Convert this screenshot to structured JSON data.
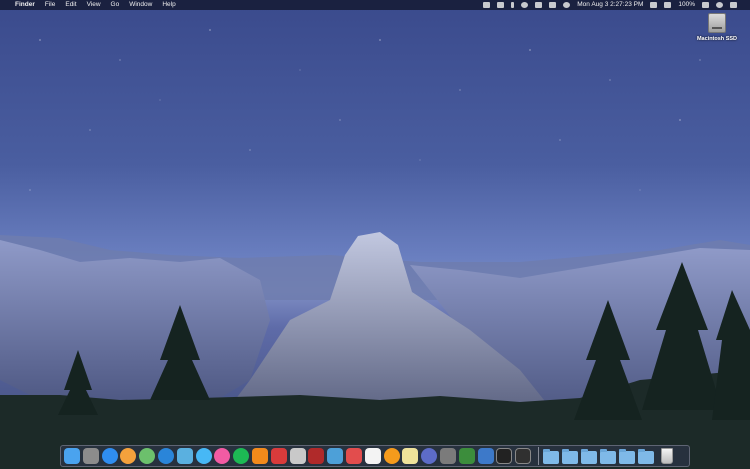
{
  "menubar": {
    "apple_glyph": "",
    "app_name": "Finder",
    "menus": [
      "File",
      "Edit",
      "View",
      "Go",
      "Window",
      "Help"
    ],
    "status": {
      "date_time": "Mon Aug 3  2:27:23 PM",
      "battery": "100%"
    }
  },
  "desktop": {
    "drive_label": "Macintosh SSD"
  },
  "dock": {
    "apps": [
      {
        "name": "finder-icon",
        "color": "#4aa3ef"
      },
      {
        "name": "system-preferences-icon",
        "color": "#8c8c8c"
      },
      {
        "name": "app-store-icon",
        "color": "#2f8df0"
      },
      {
        "name": "photos-icon",
        "color": "#f4a13c"
      },
      {
        "name": "maps-icon",
        "color": "#6cc06c"
      },
      {
        "name": "safari-icon",
        "color": "#2a85d9"
      },
      {
        "name": "preview-icon",
        "color": "#5ab0e0"
      },
      {
        "name": "messages-icon",
        "color": "#47b8f5"
      },
      {
        "name": "itunes-icon",
        "color": "#f25ba3"
      },
      {
        "name": "spotify-icon",
        "color": "#1db954"
      },
      {
        "name": "vlc-icon",
        "color": "#f28a1b"
      },
      {
        "name": "popcorn-icon",
        "color": "#d83b3b"
      },
      {
        "name": "script-editor-icon",
        "color": "#c9c9c9"
      },
      {
        "name": "tunnel-app-icon",
        "color": "#b02a2a"
      },
      {
        "name": "dolphin-icon",
        "color": "#4da0d8"
      },
      {
        "name": "flashcard-icon",
        "color": "#e24d4d"
      },
      {
        "name": "calendar-icon",
        "color": "#f3f3f3"
      },
      {
        "name": "ibooks-icon",
        "color": "#f59b1c"
      },
      {
        "name": "notes-icon",
        "color": "#efe39a"
      },
      {
        "name": "gears-app-icon",
        "color": "#5d6cc7"
      },
      {
        "name": "utility-icon",
        "color": "#7b7b7b"
      },
      {
        "name": "bbedit-icon",
        "color": "#3c8d3c"
      },
      {
        "name": "xcode-icon",
        "color": "#3d79c9"
      }
    ],
    "extras": [
      {
        "name": "terminal-icon",
        "color": "#222222"
      },
      {
        "name": "activity-monitor-icon",
        "color": "#303030"
      }
    ],
    "folders": [
      "folder-1",
      "folder-2",
      "folder-3",
      "folder-4",
      "folder-5",
      "folder-6"
    ]
  }
}
